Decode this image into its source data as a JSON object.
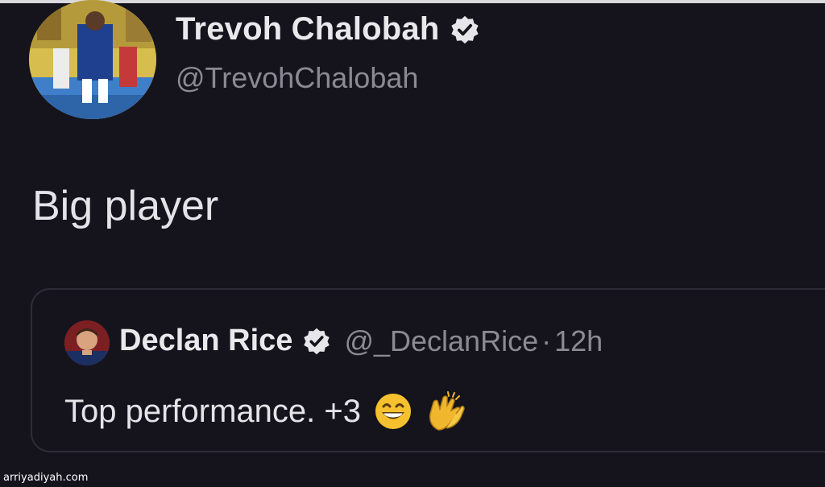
{
  "tweet": {
    "author": {
      "display_name": "Trevoh Chalobah",
      "handle": "@TrevohChalobah",
      "verified": true
    },
    "text": "Big player"
  },
  "quoted_tweet": {
    "author": {
      "display_name": "Declan Rice",
      "handle": "@_DeclanRice",
      "verified": true
    },
    "separator": "·",
    "time": "12h",
    "text": "Top performance. +3",
    "emojis": [
      "grinning-face",
      "clapping-hands"
    ]
  },
  "watermark": "arriyadiyah.com",
  "colors": {
    "background": "#15141d",
    "text_primary": "#e9e9ec",
    "text_secondary": "#8b8a93",
    "card_border": "#2e2c37"
  }
}
